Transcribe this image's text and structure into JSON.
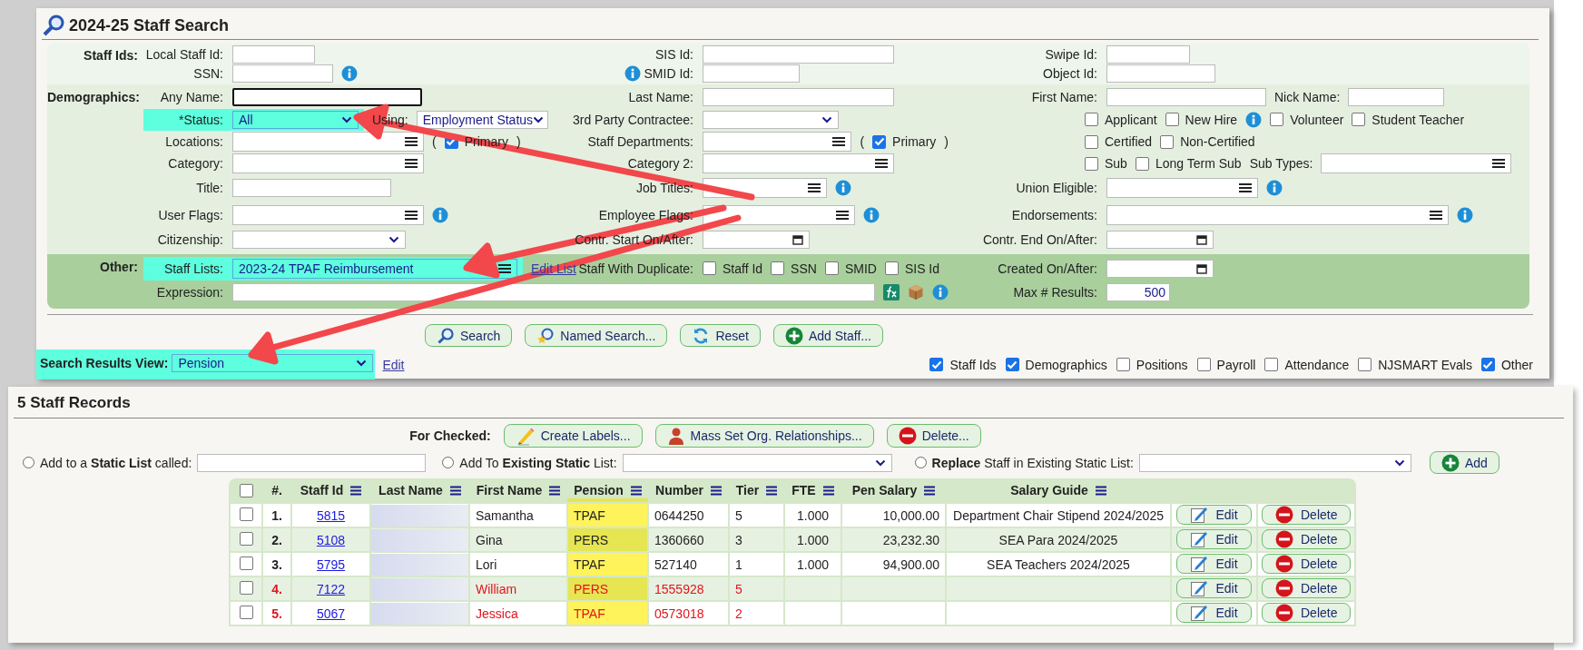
{
  "search": {
    "title": "2024-25 Staff Search",
    "sections": [
      {
        "label": "Staff Ids:",
        "rows": [
          {
            "cells": [
              {
                "label": "Local Staff Id:",
                "items": [
                  {
                    "kind": "text"
                  }
                ]
              },
              {
                "label": "SIS Id:",
                "items": [
                  {
                    "kind": "text"
                  }
                ]
              },
              {
                "label": "Swipe Id:",
                "items": [
                  {
                    "kind": "text"
                  }
                ]
              }
            ]
          },
          {
            "cells": [
              {
                "label": "SSN:",
                "items": [
                  {
                    "kind": "text"
                  },
                  {
                    "kind": "info"
                  }
                ]
              },
              {
                "label": "SMID Id:",
                "info_before_label": true,
                "items": [
                  {
                    "kind": "text"
                  }
                ]
              },
              {
                "label": "Object Id:",
                "items": [
                  {
                    "kind": "text"
                  }
                ]
              }
            ]
          }
        ]
      },
      {
        "label": "Demographics:",
        "rows": [
          {
            "cells": [
              {
                "label": "Any Name:",
                "items": [
                  {
                    "kind": "text",
                    "focused": true
                  }
                ]
              },
              {
                "label": "Last Name:",
                "items": [
                  {
                    "kind": "text"
                  }
                ]
              },
              {
                "label": "First Name:",
                "items": [
                  {
                    "kind": "text"
                  },
                  {
                    "kind": "label",
                    "text": "Nick Name:"
                  },
                  {
                    "kind": "text"
                  }
                ]
              }
            ]
          },
          {
            "cells": [
              {
                "label": "*Status:",
                "highlighted": true,
                "items": [
                  {
                    "kind": "select",
                    "value": "All"
                  },
                  {
                    "kind": "label",
                    "text": "Using:"
                  },
                  {
                    "kind": "select",
                    "value": "Employment Status"
                  }
                ]
              },
              {
                "label": "3rd Party Contractee:",
                "items": [
                  {
                    "kind": "select"
                  }
                ]
              },
              {
                "items": [
                  {
                    "kind": "checkbox",
                    "label": "Applicant",
                    "checked": false
                  },
                  {
                    "kind": "checkbox",
                    "label": "New Hire",
                    "checked": false
                  },
                  {
                    "kind": "info"
                  },
                  {
                    "kind": "checkbox",
                    "label": "Volunteer",
                    "checked": false
                  },
                  {
                    "kind": "checkbox",
                    "label": "Student Teacher",
                    "checked": false
                  }
                ]
              }
            ]
          },
          {
            "cells": [
              {
                "label": "Locations:",
                "items": [
                  {
                    "kind": "list"
                  },
                  {
                    "kind": "label",
                    "text": "("
                  },
                  {
                    "kind": "checkbox",
                    "label": "Primary",
                    "checked": true
                  },
                  {
                    "kind": "label",
                    "text": ")"
                  }
                ]
              },
              {
                "label": "Staff Departments:",
                "items": [
                  {
                    "kind": "list"
                  },
                  {
                    "kind": "label",
                    "text": "("
                  },
                  {
                    "kind": "checkbox",
                    "label": "Primary",
                    "checked": true
                  },
                  {
                    "kind": "label",
                    "text": ")"
                  }
                ]
              },
              {
                "items": [
                  {
                    "kind": "checkbox",
                    "label": "Certified",
                    "checked": false
                  },
                  {
                    "kind": "checkbox",
                    "label": "Non-Certified",
                    "checked": false
                  }
                ]
              }
            ]
          },
          {
            "cells": [
              {
                "label": "Category:",
                "items": [
                  {
                    "kind": "list"
                  }
                ]
              },
              {
                "label": "Category 2:",
                "items": [
                  {
                    "kind": "list"
                  }
                ]
              },
              {
                "items": [
                  {
                    "kind": "checkbox",
                    "label": "Sub",
                    "checked": false
                  },
                  {
                    "kind": "checkbox",
                    "label": "Long Term Sub",
                    "checked": false
                  },
                  {
                    "kind": "label",
                    "text": "Sub Types:"
                  },
                  {
                    "kind": "list"
                  }
                ]
              }
            ]
          },
          {
            "cells": [
              {
                "label": "Title:",
                "items": [
                  {
                    "kind": "text"
                  }
                ]
              },
              {
                "label": "Job Titles:",
                "items": [
                  {
                    "kind": "list"
                  },
                  {
                    "kind": "info"
                  }
                ]
              },
              {
                "label": "Union Eligible:",
                "items": [
                  {
                    "kind": "list"
                  },
                  {
                    "kind": "info"
                  }
                ]
              }
            ]
          },
          {
            "cells": [
              {
                "label": "User Flags:",
                "items": [
                  {
                    "kind": "list"
                  },
                  {
                    "kind": "info"
                  }
                ]
              },
              {
                "label": "Employee Flags:",
                "items": [
                  {
                    "kind": "list"
                  },
                  {
                    "kind": "info"
                  }
                ]
              },
              {
                "label": "Endorsements:",
                "items": [
                  {
                    "kind": "list"
                  },
                  {
                    "kind": "info"
                  }
                ]
              }
            ]
          },
          {
            "cells": [
              {
                "label": "Citizenship:",
                "items": [
                  {
                    "kind": "select"
                  }
                ]
              },
              {
                "label": "Contr. Start On/After:",
                "items": [
                  {
                    "kind": "date"
                  }
                ]
              },
              {
                "label": "Contr. End On/After:",
                "items": [
                  {
                    "kind": "date"
                  }
                ]
              }
            ]
          }
        ]
      },
      {
        "label": "Other:",
        "rows": [
          {
            "cells": [
              {
                "label": "Staff Lists:",
                "highlighted": true,
                "items": [
                  {
                    "kind": "list",
                    "value": "2023-24 TPAF Reimbursement"
                  },
                  {
                    "kind": "link",
                    "text": "Edit List"
                  }
                ]
              },
              {
                "label": "Staff With Duplicate:",
                "items": [
                  {
                    "kind": "checkbox",
                    "label": "Staff Id",
                    "checked": false
                  },
                  {
                    "kind": "checkbox",
                    "label": "SSN",
                    "checked": false
                  },
                  {
                    "kind": "checkbox",
                    "label": "SMID",
                    "checked": false
                  },
                  {
                    "kind": "checkbox",
                    "label": "SIS Id",
                    "checked": false
                  }
                ]
              },
              {
                "label": "Created On/After:",
                "items": [
                  {
                    "kind": "date"
                  }
                ]
              }
            ]
          },
          {
            "cells": [
              {
                "label": "Expression:",
                "items": [
                  {
                    "kind": "text"
                  },
                  {
                    "kind": "formula"
                  },
                  {
                    "kind": "package"
                  },
                  {
                    "kind": "info"
                  }
                ]
              },
              "",
              {
                "label": "Max # Results:",
                "items": [
                  {
                    "kind": "number",
                    "value": "500"
                  }
                ]
              }
            ]
          }
        ]
      }
    ],
    "buttons": [
      "Search",
      "Named Search...",
      "Reset",
      "Add Staff..."
    ],
    "results_view": {
      "label": "Search Results View:",
      "value": "Pension",
      "highlighted": true,
      "link": "Edit"
    },
    "show_groups": [
      {
        "label": "Staff Ids",
        "checked": true
      },
      {
        "label": "Demographics",
        "checked": true
      },
      {
        "label": "Positions",
        "checked": false
      },
      {
        "label": "Payroll",
        "checked": false
      },
      {
        "label": "Attendance",
        "checked": false
      },
      {
        "label": "NJSMART Evals",
        "checked": false
      },
      {
        "label": "Other",
        "checked": true
      }
    ]
  },
  "records": {
    "title": "5 Staff Records",
    "for_checked": "For Checked:",
    "actions": [
      "Create Labels...",
      "Mass Set Org. Relationships...",
      "Delete..."
    ],
    "static_list": [
      {
        "kind": "text",
        "label": "Add to a **Static List** called:",
        "selected": false
      },
      {
        "kind": "select",
        "label": "Add To **Existing Static** List:",
        "selected": false
      },
      {
        "kind": "select",
        "label": "**Replace** Staff in Existing Static List:",
        "selected": false
      }
    ],
    "add_button": "Add",
    "table": {
      "all_checked": false,
      "columns": [
        {
          "label": "#.",
          "menu": false
        },
        {
          "label": "Staff Id",
          "menu": true
        },
        {
          "label": "Last Name",
          "menu": true
        },
        {
          "label": "First Name",
          "menu": true
        },
        {
          "label": "Pension",
          "menu": true,
          "highlighted": true
        },
        {
          "label": "Number",
          "menu": true
        },
        {
          "label": "Tier",
          "menu": true
        },
        {
          "label": "FTE",
          "menu": true
        },
        {
          "label": "Pen Salary",
          "menu": true
        },
        {
          "label": "Salary Guide",
          "menu": true
        }
      ],
      "rows": [
        {
          "checked": false,
          "inactive": false,
          "num": "1.",
          "staff_id": "5815",
          "first_name": "Samantha",
          "pension": "TPAF",
          "number": "0644250",
          "tier": "5",
          "fte": "1.000",
          "pen_salary": "10,000.00",
          "salary_guide": "Department Chair Stipend 2024/2025",
          "edit": "Edit",
          "delete": "Delete"
        },
        {
          "checked": false,
          "inactive": false,
          "num": "2.",
          "staff_id": "5108",
          "first_name": "Gina",
          "pension": "PERS",
          "number": "1360660",
          "tier": "3",
          "fte": "1.000",
          "pen_salary": "23,232.30",
          "salary_guide": "SEA Para 2024/2025",
          "edit": "Edit",
          "delete": "Delete"
        },
        {
          "checked": false,
          "inactive": false,
          "num": "3.",
          "staff_id": "5795",
          "first_name": "Lori",
          "pension": "TPAF",
          "number": "527140",
          "tier": "1",
          "fte": "1.000",
          "pen_salary": "94,900.00",
          "salary_guide": "SEA Teachers 2024/2025",
          "edit": "Edit",
          "delete": "Delete"
        },
        {
          "checked": false,
          "inactive": true,
          "num": "4.",
          "staff_id": "7122",
          "first_name": "William",
          "pension": "PERS",
          "number": "1555928",
          "tier": "5",
          "edit": "Edit",
          "delete": "Delete"
        },
        {
          "checked": false,
          "inactive": true,
          "num": "5.",
          "staff_id": "5067",
          "first_name": "Jessica",
          "pension": "TPAF",
          "number": "0573018",
          "tier": "2",
          "edit": "Edit",
          "delete": "Delete"
        }
      ]
    }
  }
}
